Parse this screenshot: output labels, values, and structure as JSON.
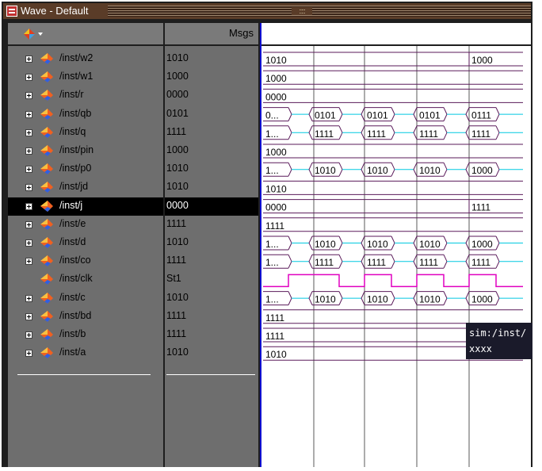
{
  "window": {
    "title": "Wave - Default"
  },
  "header": {
    "msgs_label": "Msgs"
  },
  "tooltip": {
    "line1": "sim:/inst/",
    "line2": "xxxx"
  },
  "colors": {
    "bus": "#5a1a5a",
    "clk": "#e000c0",
    "bus_alt": "#00c8e0",
    "grid": "#5a5a5a",
    "cursor": "#1010d0"
  },
  "signals": [
    {
      "name": "/inst/w2",
      "value": "1010",
      "expandable": true
    },
    {
      "name": "/inst/w1",
      "value": "1000",
      "expandable": true
    },
    {
      "name": "/inst/r",
      "value": "0000",
      "expandable": true
    },
    {
      "name": "/inst/qb",
      "value": "0101",
      "expandable": true
    },
    {
      "name": "/inst/q",
      "value": "1111",
      "expandable": true
    },
    {
      "name": "/inst/pin",
      "value": "1000",
      "expandable": true
    },
    {
      "name": "/inst/p0",
      "value": "1010",
      "expandable": true
    },
    {
      "name": "/inst/jd",
      "value": "1010",
      "expandable": true
    },
    {
      "name": "/inst/j",
      "value": "0000",
      "expandable": true,
      "selected": true
    },
    {
      "name": "/inst/e",
      "value": "1111",
      "expandable": true
    },
    {
      "name": "/inst/d",
      "value": "1010",
      "expandable": true
    },
    {
      "name": "/inst/co",
      "value": "1111",
      "expandable": true
    },
    {
      "name": "/inst/clk",
      "value": "St1",
      "expandable": false
    },
    {
      "name": "/inst/c",
      "value": "1010",
      "expandable": true
    },
    {
      "name": "/inst/bd",
      "value": "1111",
      "expandable": true
    },
    {
      "name": "/inst/b",
      "value": "1111",
      "expandable": true
    },
    {
      "name": "/inst/a",
      "value": "1010",
      "expandable": true
    }
  ],
  "waves": [
    {
      "type": "bus",
      "segments": [
        {
          "label": "1010"
        },
        {
          "label": "1000",
          "fromCol": 4
        }
      ]
    },
    {
      "type": "bus",
      "segments": [
        {
          "label": "1000"
        }
      ]
    },
    {
      "type": "bus",
      "segments": [
        {
          "label": "0000"
        }
      ]
    },
    {
      "type": "toggle",
      "labels": [
        "0...",
        "0101",
        "0101",
        "0101",
        "0111"
      ]
    },
    {
      "type": "toggle",
      "labels": [
        "1...",
        "1111",
        "1111",
        "1111",
        "1111"
      ]
    },
    {
      "type": "bus",
      "segments": [
        {
          "label": "1000"
        }
      ]
    },
    {
      "type": "toggle",
      "labels": [
        "1...",
        "1010",
        "1010",
        "1010",
        "1000"
      ]
    },
    {
      "type": "bus",
      "segments": [
        {
          "label": "1010"
        }
      ]
    },
    {
      "type": "bus",
      "segments": [
        {
          "label": "0000"
        },
        {
          "label": "1111",
          "fromCol": 4
        }
      ]
    },
    {
      "type": "bus",
      "segments": [
        {
          "label": "1111"
        }
      ]
    },
    {
      "type": "toggle",
      "labels": [
        "1...",
        "1010",
        "1010",
        "1010",
        "1000"
      ]
    },
    {
      "type": "toggle",
      "labels": [
        "1...",
        "1111",
        "1111",
        "1111",
        "1111"
      ]
    },
    {
      "type": "clock"
    },
    {
      "type": "toggle",
      "labels": [
        "1...",
        "1010",
        "1010",
        "1010",
        "1000"
      ]
    },
    {
      "type": "bus",
      "segments": [
        {
          "label": "1111"
        }
      ]
    },
    {
      "type": "bus",
      "segments": [
        {
          "label": "1111"
        }
      ]
    },
    {
      "type": "bus",
      "segments": [
        {
          "label": "1010"
        }
      ]
    }
  ]
}
